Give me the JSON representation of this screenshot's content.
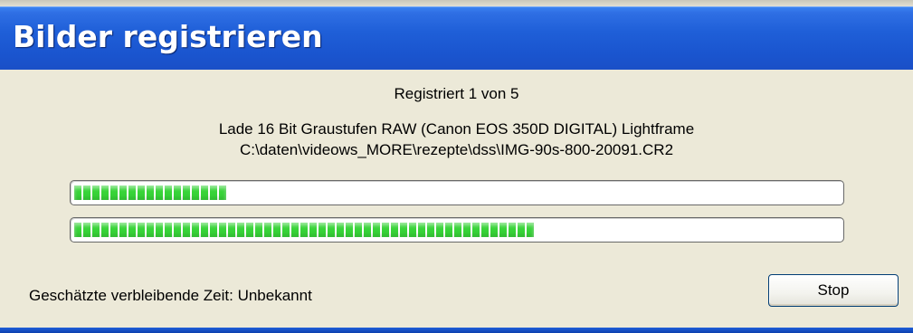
{
  "window": {
    "title": "Bilder registrieren"
  },
  "progress_info": {
    "registered_text": "Registriert 1 von 5",
    "loading_text": "Lade 16 Bit Graustufen RAW (Canon EOS 350D DIGITAL) Lightframe",
    "file_path": "C:\\daten\\videows_MORE\\rezepte\\dss\\IMG-90s-800-20091.CR2"
  },
  "progress_bars": [
    {
      "name": "file-progress",
      "fraction": 0.2
    },
    {
      "name": "overall-progress",
      "fraction": 0.6
    }
  ],
  "status": {
    "remaining_time": "Geschätzte verbleibende Zeit: Unbekannt"
  },
  "buttons": {
    "stop_label": "Stop"
  },
  "colors": {
    "titlebar": "#1F5FD8",
    "background": "#ECE9D8",
    "progress_fill": "#37D338"
  }
}
